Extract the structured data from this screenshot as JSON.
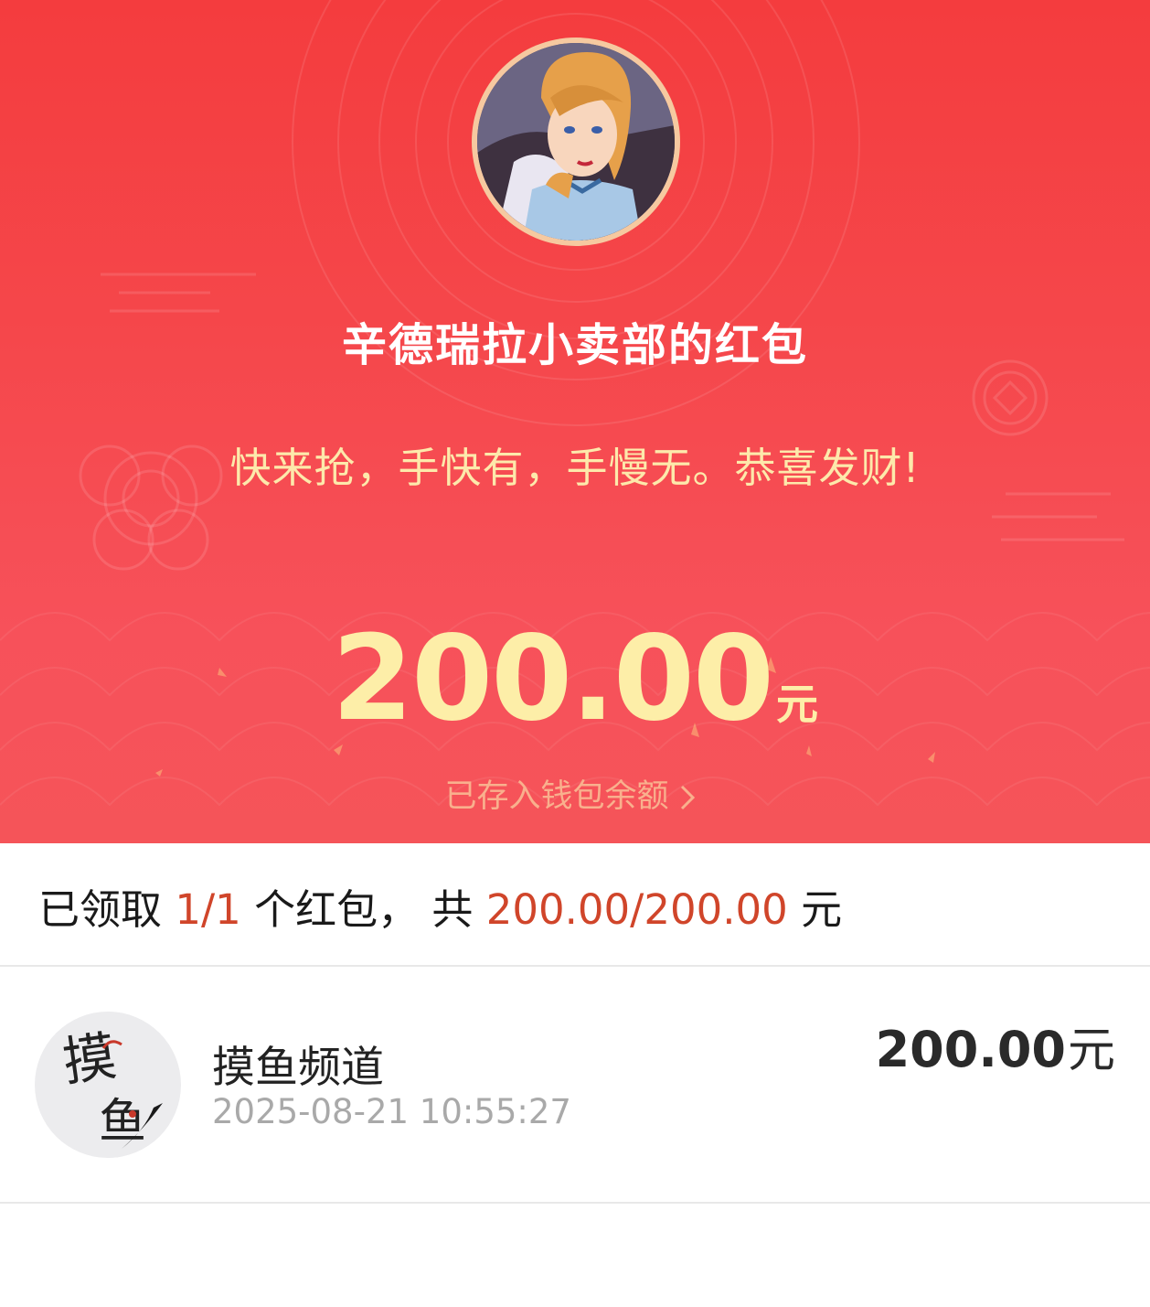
{
  "header": {
    "sender_title": "辛德瑞拉小卖部的红包",
    "greeting": "快来抢，手快有，手慢无。恭喜发财!",
    "amount": "200.00",
    "amount_unit": "元",
    "wallet_link": "已存入钱包余额",
    "colors": {
      "background": "#f5474b",
      "amount": "#fdeea8",
      "greeting": "#fde9ab",
      "link": "#f9b08d"
    }
  },
  "summary": {
    "prefix": "已领取",
    "count": "1/1",
    "middle": "个红包，",
    "total_label": "共",
    "total_value": "200.00/200.00",
    "unit": "元",
    "highlight_color": "#d0452a"
  },
  "records": [
    {
      "name": "摸鱼频道",
      "time": "2025-08-21 10:55:27",
      "amount": "200.00",
      "unit": "元",
      "avatar_glyphs": "摸鱼"
    }
  ],
  "icons": {
    "wallet_link_icon": "chevron-right-icon"
  }
}
